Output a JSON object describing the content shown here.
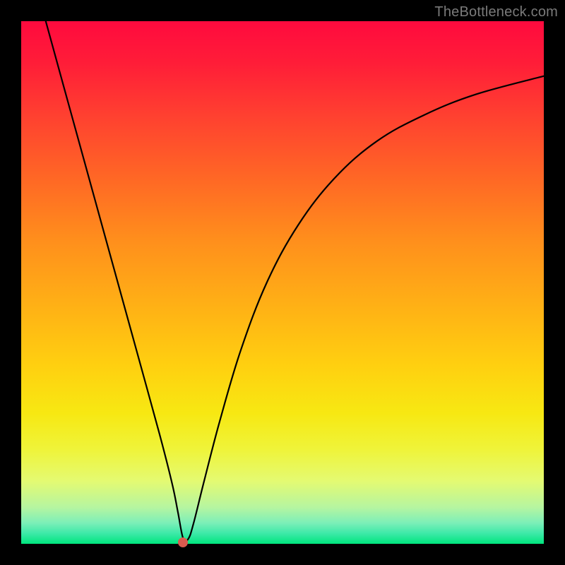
{
  "credit": "TheBottleneck.com",
  "dot": {
    "x_frac": 0.31,
    "y_frac": 0.997
  },
  "chart_data": {
    "type": "line",
    "title": "",
    "xlabel": "",
    "ylabel": "",
    "xlim": [
      0,
      1
    ],
    "ylim": [
      0,
      1
    ],
    "series": [
      {
        "name": "curve",
        "x": [
          0.047,
          0.08,
          0.12,
          0.16,
          0.2,
          0.24,
          0.27,
          0.29,
          0.3,
          0.31,
          0.32,
          0.33,
          0.35,
          0.38,
          0.42,
          0.47,
          0.53,
          0.6,
          0.68,
          0.77,
          0.87,
          1.0
        ],
        "y": [
          1.0,
          0.88,
          0.735,
          0.59,
          0.445,
          0.3,
          0.19,
          0.11,
          0.06,
          0.01,
          0.01,
          0.04,
          0.12,
          0.235,
          0.37,
          0.5,
          0.61,
          0.7,
          0.77,
          0.82,
          0.86,
          0.895
        ]
      }
    ],
    "marker": {
      "x": 0.31,
      "y": 0.003
    }
  }
}
